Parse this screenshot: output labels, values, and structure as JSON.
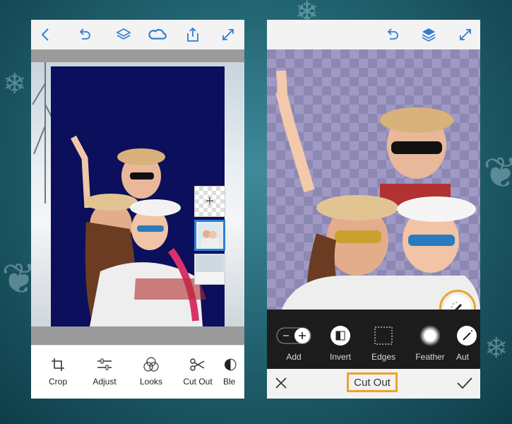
{
  "left_screen": {
    "topbar_icons": [
      "back-chevron-icon",
      "undo-icon",
      "layers-icon",
      "creative-cloud-icon",
      "share-icon",
      "expand-icon"
    ],
    "tools": [
      {
        "label": "Crop",
        "icon": "crop-icon"
      },
      {
        "label": "Adjust",
        "icon": "adjust-sliders-icon"
      },
      {
        "label": "Looks",
        "icon": "looks-circles-icon"
      },
      {
        "label": "Cut Out",
        "icon": "scissors-icon"
      },
      {
        "label": "Ble",
        "icon": "blend-icon"
      }
    ],
    "layer_add_symbol": "+"
  },
  "right_screen": {
    "topbar_icons": [
      "undo-icon",
      "layers-icon",
      "expand-icon"
    ],
    "tools": [
      {
        "label": "Add",
        "icon": "add-toggle-icon"
      },
      {
        "label": "Invert",
        "icon": "invert-icon"
      },
      {
        "label": "Edges",
        "icon": "edges-icon"
      },
      {
        "label": "Feather",
        "icon": "feather-icon"
      },
      {
        "label": "Aut",
        "icon": "auto-wand-icon"
      }
    ],
    "footer": {
      "title": "Cut Out",
      "close_icon": "close-icon",
      "confirm_icon": "checkmark-icon"
    }
  },
  "colors": {
    "accent_blue": "#2d7fd6",
    "highlight_orange": "#f0a12b",
    "navy": "#0b0f5c",
    "checker": "#8d87b4"
  }
}
